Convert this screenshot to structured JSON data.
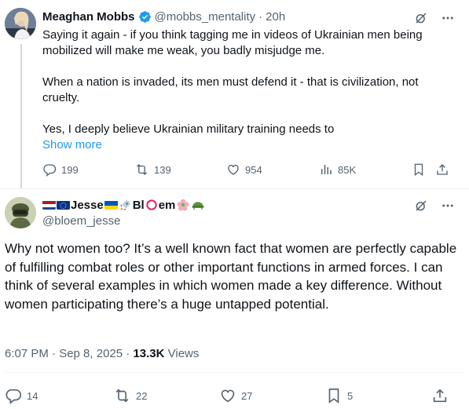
{
  "parent_tweet": {
    "author_name": "Meaghan Mobbs",
    "handle": "@mobbs_mentality",
    "separator": "·",
    "time": "20h",
    "paragraphs": [
      "Saying it again - if you think tagging me in videos of Ukrainian men being mobilized will make me weak, you badly misjudge me.",
      "When a nation is invaded, its men must defend it - that is civilization, not cruelty.",
      "Yes, I deeply believe Ukrainian military training needs to"
    ],
    "show_more": "Show more",
    "stats": {
      "replies": "199",
      "reposts": "139",
      "likes": "954",
      "views": "85K"
    }
  },
  "main_tweet": {
    "author_name_prefix": "Jesse",
    "author_name_mid": "Bl",
    "author_name_suffix": "em",
    "handle": "@bloem_jesse",
    "text": "Why not women too? It’s a well known fact that women are perfectly capable of fulfilling combat roles or other important functions in armed forces. I can think of several examples in which women made a key difference. Without women participating there’s a huge untapped potential.",
    "timestamp": "6:07 PM · Sep 8, 2025 · ",
    "views_count": "13.3K",
    "views_label": " Views",
    "stats": {
      "replies": "14",
      "reposts": "22",
      "likes": "27",
      "bookmarks": "5"
    }
  },
  "colors": {
    "link": "#1d9bf0",
    "verified": "#1d9bf0",
    "muted": "#536471",
    "text": "#0f1419"
  }
}
